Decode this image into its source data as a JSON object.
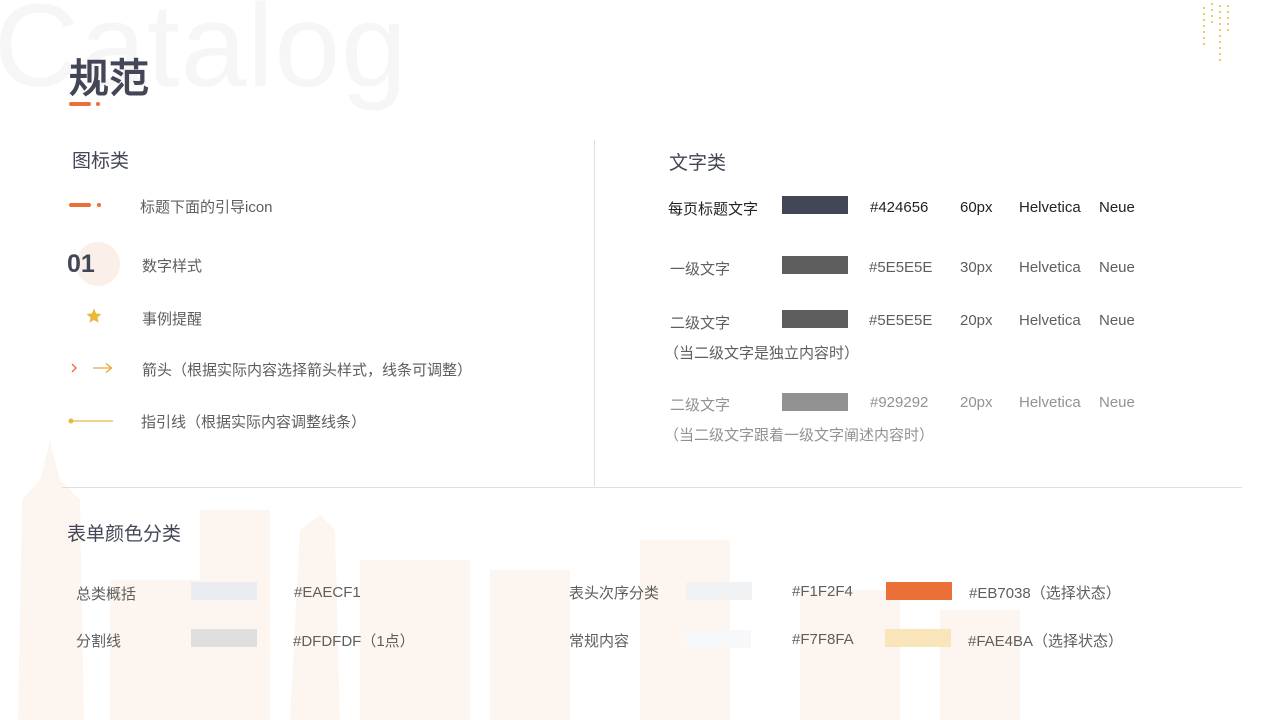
{
  "watermark": "Catalog",
  "page_title": "规范",
  "icons_section": {
    "heading": "图标类",
    "items": [
      {
        "label": "标题下面的引导icon"
      },
      {
        "number": "01",
        "label": "数字样式"
      },
      {
        "label": "事例提醒"
      },
      {
        "label": "箭头（根据实际内容选择箭头样式，线条可调整）"
      },
      {
        "label": "指引线（根据实际内容调整线条）"
      }
    ]
  },
  "text_section": {
    "heading": "文字类",
    "rows": [
      {
        "name": "每页标题文字",
        "hex": "#424656",
        "size": "60px",
        "font1": "Helvetica",
        "font2": "Neue",
        "swatch": "#424656"
      },
      {
        "name": "一级文字",
        "hex": "#5E5E5E",
        "size": "30px",
        "font1": "Helvetica",
        "font2": "Neue",
        "swatch": "#5E5E5E"
      },
      {
        "name": "二级文字",
        "note": "（当二级文字是独立内容时）",
        "hex": "#5E5E5E",
        "size": "20px",
        "font1": "Helvetica",
        "font2": "Neue",
        "swatch": "#5E5E5E"
      },
      {
        "name": "二级文字",
        "note": "（当二级文字跟着一级文字阐述内容时）",
        "hex": "#929292",
        "size": "20px",
        "font1": "Helvetica",
        "font2": "Neue",
        "swatch": "#929292"
      }
    ]
  },
  "color_section": {
    "heading": "表单颜色分类",
    "left": [
      {
        "name": "总类概括",
        "hex": "#EAECF1",
        "swatch": "#EAECF1"
      },
      {
        "name": "分割线",
        "hex": "#DFDFDF（1点）",
        "swatch": "#DFDFDF"
      }
    ],
    "right": [
      {
        "name": "表头次序分类",
        "hex": "#F1F2F4",
        "swatch": "#F1F2F4",
        "sel_hex": "#EB7038（选择状态）",
        "sel_swatch": "#EB7038"
      },
      {
        "name": "常规内容",
        "hex": "#F7F8FA",
        "swatch": "#F7F8FA",
        "sel_hex": "#FAE4BA（选择状态）",
        "sel_swatch": "#FAE4BA"
      }
    ]
  },
  "colors": {
    "accent": "#EB7038",
    "gold": "#E8B93A",
    "title": "#424656"
  }
}
